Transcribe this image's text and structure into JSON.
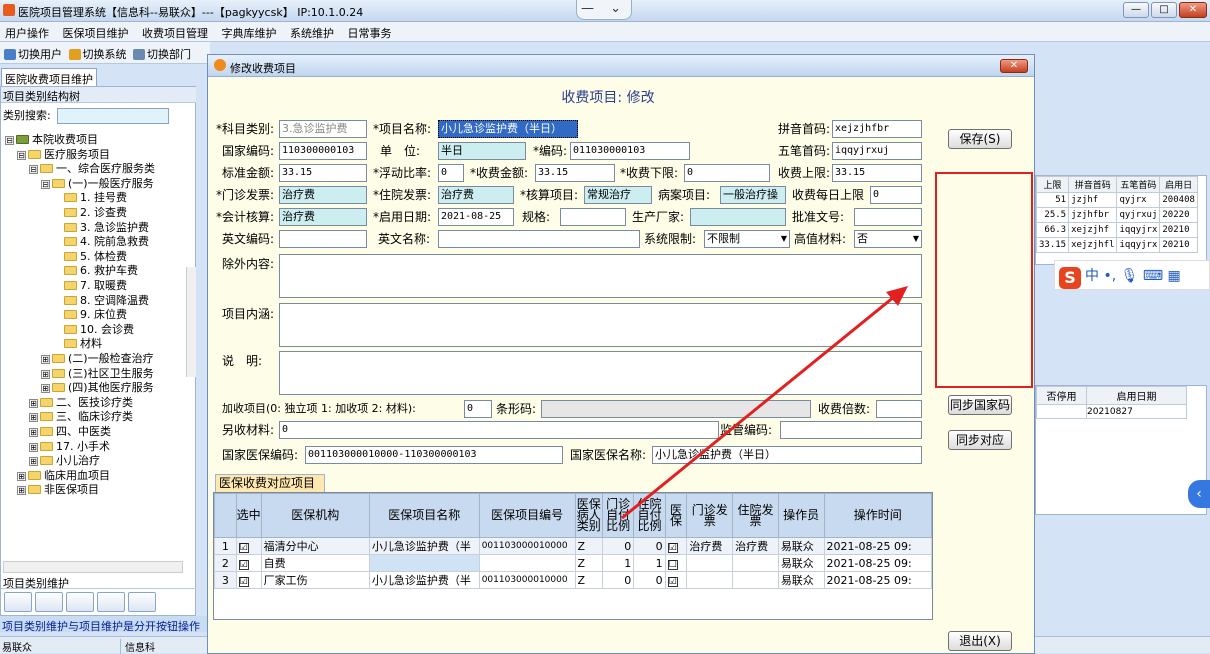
{
  "window": {
    "title": "医院项目管理系统【信息科--易联众】---【pagkyycsk】 IP:10.1.0.24",
    "center_btn": "— ⌄",
    "min": "—",
    "max": "□",
    "close": "✕"
  },
  "menu": [
    "用户操作",
    "医保项目维护",
    "收费项目管理",
    "字典库维护",
    "系统维护",
    "日常事务"
  ],
  "toolbar": [
    "切换用户",
    "切换系统",
    "切换部门"
  ],
  "tab": "医院收费项目维护",
  "left": {
    "header": "项目类别结构树",
    "search_label": "类别搜索:",
    "footer_label": "项目类别维护",
    "status": "项目类别维护与项目维护是分开按钮操作"
  },
  "tree": [
    {
      "d": 0,
      "pm": "⊟",
      "t": "本院收费项目",
      "root": true
    },
    {
      "d": 1,
      "pm": "⊟",
      "t": "医疗服务项目"
    },
    {
      "d": 2,
      "pm": "⊟",
      "t": "一、综合医疗服务类"
    },
    {
      "d": 3,
      "pm": "⊟",
      "t": "(一)一般医疗服务"
    },
    {
      "d": 4,
      "pm": "",
      "t": "1. 挂号费"
    },
    {
      "d": 4,
      "pm": "",
      "t": "2. 诊查费"
    },
    {
      "d": 4,
      "pm": "",
      "t": "3. 急诊监护费"
    },
    {
      "d": 4,
      "pm": "",
      "t": "4. 院前急救费"
    },
    {
      "d": 4,
      "pm": "",
      "t": "5. 体检费"
    },
    {
      "d": 4,
      "pm": "",
      "t": "6. 救护车费"
    },
    {
      "d": 4,
      "pm": "",
      "t": "7. 取暖费"
    },
    {
      "d": 4,
      "pm": "",
      "t": "8. 空调降温费"
    },
    {
      "d": 4,
      "pm": "",
      "t": "9. 床位费"
    },
    {
      "d": 4,
      "pm": "",
      "t": "10. 会诊费"
    },
    {
      "d": 4,
      "pm": "",
      "t": "材料"
    },
    {
      "d": 3,
      "pm": "⊞",
      "t": "(二)一般检查治疗"
    },
    {
      "d": 3,
      "pm": "⊞",
      "t": "(三)社区卫生服务"
    },
    {
      "d": 3,
      "pm": "⊞",
      "t": "(四)其他医疗服务"
    },
    {
      "d": 2,
      "pm": "⊞",
      "t": "二、医技诊疗类"
    },
    {
      "d": 2,
      "pm": "⊞",
      "t": "三、临床诊疗类"
    },
    {
      "d": 2,
      "pm": "⊞",
      "t": "四、中医类"
    },
    {
      "d": 2,
      "pm": "⊞",
      "t": "17. 小手术"
    },
    {
      "d": 2,
      "pm": "⊞",
      "t": "小儿治疗"
    },
    {
      "d": 1,
      "pm": "⊞",
      "t": "临床用血项目"
    },
    {
      "d": 1,
      "pm": "⊞",
      "t": "非医保项目"
    }
  ],
  "statusbar": {
    "user": "易联众",
    "dept": "信息科"
  },
  "bg_grid": {
    "headers": [
      "上限",
      "拼音首码",
      "五笔首码",
      "启用日"
    ],
    "rows": [
      [
        "51",
        "jzjhf",
        "qyjrx",
        "200408"
      ],
      [
        "25.5",
        "jzjhfbr",
        "qyjrxuj",
        "20220"
      ],
      [
        "66.3",
        "xejzjhf",
        "iqqyjrx",
        "20210"
      ],
      [
        "33.15",
        "xejzjhfl",
        "iqqyjrx",
        "20210"
      ]
    ]
  },
  "bg_grid2": {
    "headers": [
      "否停用",
      "启用日期"
    ],
    "rows": [
      [
        "",
        "20210827"
      ]
    ]
  },
  "ime": {
    "logo": "S",
    "items": "中 •, 🎙 ⌨ ▦"
  },
  "side_toggle": "‹",
  "dialog": {
    "title": "修改收费项目",
    "close": "✕",
    "heading": "收费项目: 修改",
    "labels": {
      "category": "*科目类别:",
      "name": "*项目名称:",
      "pinyin": "拼音首码:",
      "national_code": "国家编码:",
      "unit": "单　位:",
      "code": "*编码:",
      "wubi": "五笔首码:",
      "std_amount": "标准金额:",
      "float": "*浮动比率:",
      "fee": "*收费金额:",
      "lower": "*收费下限:",
      "upper": "收费上限:",
      "outpatient_inv": "*门诊发票:",
      "inpatient_inv": "*住院发票:",
      "account_item": "*核算项目:",
      "case_item": "病案项目:",
      "daily_cap": "收费每日上限",
      "acct": "*会计核算:",
      "start_date": "*启用日期:",
      "spec": "规格:",
      "maker": "生产厂家:",
      "approval": "批准文号:",
      "en_code": "英文编码:",
      "en_name": "英文名称:",
      "sys_limit": "系统限制:",
      "high_value": "高值材料:",
      "excl": "除外内容:",
      "content": "项目内涵:",
      "remark": "说　明:",
      "addon": "加收项目(0: 独立项 1: 加收项 2: 材料):",
      "barcode": "条形码:",
      "multiple": "收费倍数:",
      "other_fee": "另收材料:",
      "supervise": "监管编码:",
      "nhsa_code": "国家医保编码:",
      "nhsa_name": "国家医保名称:"
    },
    "values": {
      "category": "3.急诊监护费",
      "name": "小儿急诊监护费（半日）",
      "pinyin": "xejzjhfbr",
      "national_code": "110300000103",
      "unit": "半日",
      "code": "011030000103",
      "wubi": "iqqyjrxuj",
      "std_amount": "33.15",
      "float": "0",
      "fee": "33.15",
      "lower": "0",
      "upper": "33.15",
      "outpatient_inv": "治疗费",
      "inpatient_inv": "治疗费",
      "account_item": "常规治疗",
      "case_item": "一般治疗操",
      "daily_cap": "0",
      "acct": "治疗费",
      "start_date": "2021-08-25",
      "spec": "",
      "maker": "",
      "approval": "",
      "en_code": "",
      "en_name": "",
      "sys_limit": "不限制",
      "high_value": "否",
      "addon": "0",
      "barcode": "",
      "multiple": "",
      "other_fee": "0",
      "supervise": "",
      "nhsa_code": "001103000010000-110300000103",
      "nhsa_name": "小儿急诊监护费（半日）"
    },
    "buttons": {
      "save": "保存(S)",
      "sync_national": "同步国家码",
      "sync_map": "同步对应",
      "exit": "退出(X)"
    },
    "subtab": "医保收费对应项目",
    "grid": {
      "headers": [
        "",
        "选中",
        "医保机构",
        "医保项目名称",
        "医保项目编号",
        "医保病人类别",
        "门诊自付比例",
        "住院自付比例",
        "医保",
        "门诊发票",
        "住院发票",
        "操作员",
        "操作时间"
      ],
      "rows": [
        [
          "1",
          "☑",
          "福清分中心",
          "小儿急诊监护费（半",
          "001103000010000",
          "Z",
          "0",
          "0",
          "☑",
          "治疗费",
          "治疗费",
          "易联众",
          "2021-08-25 09:"
        ],
        [
          "2",
          "☑",
          "自费",
          "",
          "",
          "Z",
          "1",
          "1",
          "☐",
          "",
          "",
          "易联众",
          "2021-08-25 09:"
        ],
        [
          "3",
          "☑",
          "厂家工伤",
          "小儿急诊监护费（半",
          "001103000010000",
          "Z",
          "0",
          "0",
          "☑",
          "",
          "",
          "易联众",
          "2021-08-25 09:"
        ]
      ]
    }
  }
}
